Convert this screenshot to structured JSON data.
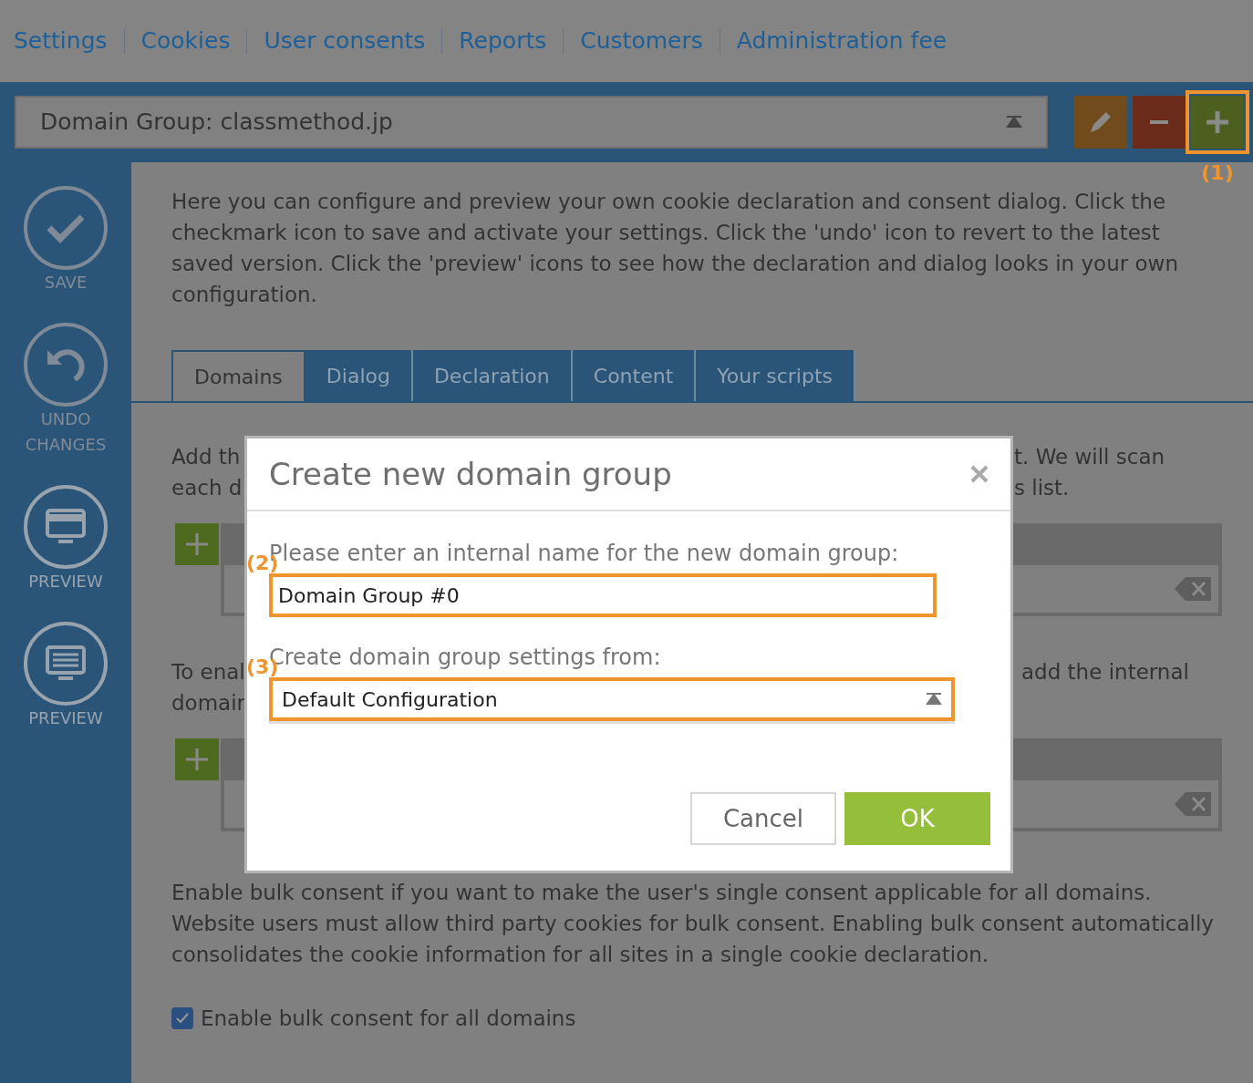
{
  "nav": {
    "links": [
      "Settings",
      "Cookies",
      "User consents",
      "Reports",
      "Customers",
      "Administration fee"
    ]
  },
  "domain_select": {
    "value": "Domain Group: classmethod.jp"
  },
  "header_buttons": [
    {
      "kind": "edit",
      "highlighted": false
    },
    {
      "kind": "remove",
      "highlighted": false
    },
    {
      "kind": "add",
      "highlighted": true,
      "callout": "(1)"
    }
  ],
  "sidebar": {
    "items": [
      {
        "kind": "save",
        "label": "SAVE"
      },
      {
        "kind": "undo",
        "label": "UNDO CHANGES"
      },
      {
        "kind": "preview-banner",
        "label": "PREVIEW"
      },
      {
        "kind": "preview-dialog",
        "label": "PREVIEW"
      }
    ]
  },
  "intro": "Here you can configure and preview your own cookie declaration and consent dialog. Click the checkmark icon to save and activate your settings. Click the 'undo' icon to revert to the latest saved version. Click the 'preview' icons to see how the declaration and dialog looks in your own configuration.",
  "tabs": [
    {
      "label": "Domains",
      "selected": true
    },
    {
      "label": "Dialog",
      "selected": false
    },
    {
      "label": "Declaration",
      "selected": false
    },
    {
      "label": "Content",
      "selected": false
    },
    {
      "label": "Your scripts",
      "selected": false
    }
  ],
  "sections": [
    {
      "left_lines": [
        "Add th",
        "each d"
      ],
      "right_lines": [
        "t. We will scan",
        "s list."
      ]
    },
    {
      "left_lines": [
        "To enal",
        "domair"
      ],
      "right_lines": [
        "add the internal"
      ]
    }
  ],
  "bulk_consent": {
    "text": "Enable bulk consent if you want to make the user's single consent applicable for all domains. Website users must allow third party cookies for bulk consent. Enabling bulk consent automatically consolidates the cookie information for all sites in a single cookie declaration.",
    "checkbox": {
      "label": "Enable bulk consent for all domains",
      "checked": true
    }
  },
  "modal": {
    "title": "Create new domain group",
    "name_label": "Please enter an internal name for the new domain group:",
    "name_value": "Domain Group #0",
    "name_callout": "(2)",
    "source_label": "Create domain group settings from:",
    "source_value": "Default Configuration",
    "source_callout": "(3)",
    "buttons": [
      {
        "kind": "cancel",
        "label": "Cancel"
      },
      {
        "kind": "ok",
        "label": "OK"
      }
    ]
  }
}
